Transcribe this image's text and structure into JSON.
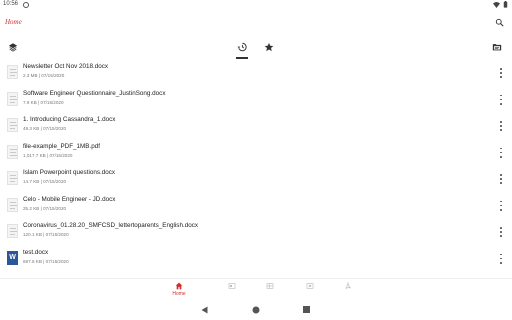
{
  "status": {
    "time": "10:56"
  },
  "app": {
    "title": "Home"
  },
  "tabs": [
    {
      "icon": "history-icon",
      "selected": true
    },
    {
      "icon": "star-icon",
      "selected": false
    }
  ],
  "files": [
    {
      "name": "Newsletter Oct Nov 2018.docx",
      "meta": "2.3 MB | 07/15/2020",
      "type": "doc"
    },
    {
      "name": "Software Engineer Questionnaire_JustinSong.docx",
      "meta": "7.9 KB | 07/15/2020",
      "type": "doc"
    },
    {
      "name": "1. Introducing Cassandra_1.docx",
      "meta": "49.3 KB | 07/15/2020",
      "type": "doc"
    },
    {
      "name": "file-example_PDF_1MB.pdf",
      "meta": "1,017.7 KB | 07/15/2020",
      "type": "pdf"
    },
    {
      "name": "Islam Powerpoint questions.docx",
      "meta": "14.7 KB | 07/15/2020",
      "type": "doc"
    },
    {
      "name": "Celo - Mobile Engineer - JD.docx",
      "meta": "25.2 KB | 07/15/2020",
      "type": "doc"
    },
    {
      "name": "Coronavirus_01.28.20_SMFCSD_lettertoparents_English.docx",
      "meta": "120.1 KB | 07/15/2020",
      "type": "doc"
    },
    {
      "name": "test.docx",
      "meta": "687.6 KB | 07/15/2020",
      "type": "word"
    }
  ],
  "bottom_nav": {
    "home_label": "Home",
    "items": [
      "home-icon",
      "doc-icon",
      "sheet-icon",
      "slides-icon",
      "pdf-icon"
    ]
  },
  "colors": {
    "accent": "#d32f2f",
    "inactive": "#bdbdbd"
  }
}
